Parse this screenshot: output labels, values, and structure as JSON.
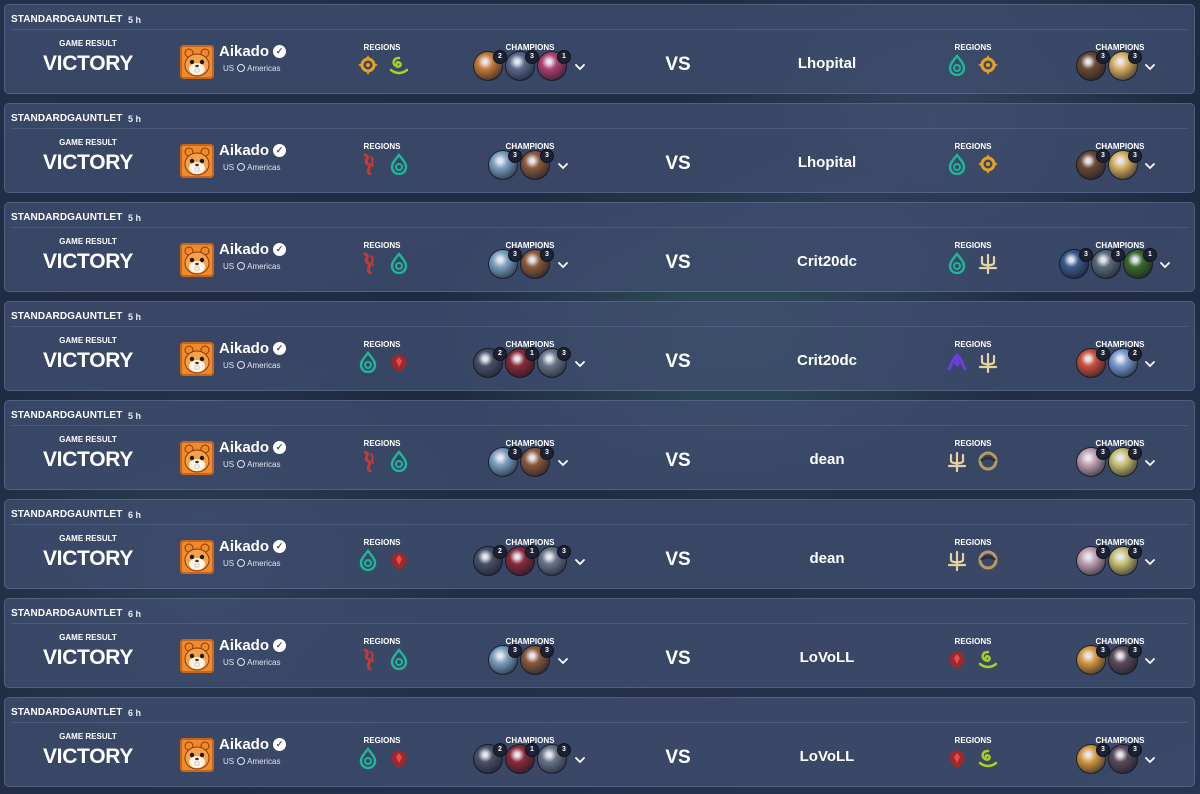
{
  "labels": {
    "game_result": "GAME RESULT",
    "regions": "REGIONS",
    "champions": "CHAMPIONS",
    "vs": "VS"
  },
  "player": {
    "name": "Aikado",
    "server": "US",
    "region": "Americas",
    "avatar_icon": "hamster-avatar-icon",
    "verified_icon": "verified-check-icon"
  },
  "colors": {
    "card_bg": "#404e70",
    "text": "#ffffff",
    "teal_region": "#1fb59a",
    "orange_region": "#e8a020",
    "green_region": "#a8d020",
    "red_region": "#c83a30",
    "noxus_region": "#a02828",
    "bilgewater_region": "#e6d2a0",
    "purple_region": "#6a3ee0",
    "shurima_region": "#b89a60"
  },
  "matches": [
    {
      "mode": "STANDARDGAUNTLET",
      "time": "5 h",
      "result": "VICTORY",
      "player_regions": [
        "targon-orange-icon",
        "bandle-green-icon"
      ],
      "player_champions": [
        {
          "count": "2",
          "color": "#c77a3a"
        },
        {
          "count": "3",
          "color": "#5a6a8a"
        },
        {
          "count": "1",
          "color": "#b04070"
        }
      ],
      "opponent": "Lhopital",
      "opponent_regions": [
        "shadow-isles-teal-icon",
        "targon-orange-icon"
      ],
      "opponent_champions": [
        {
          "count": "3",
          "color": "#6a4a32"
        },
        {
          "count": "3",
          "color": "#d8b060"
        }
      ]
    },
    {
      "mode": "STANDARDGAUNTLET",
      "time": "5 h",
      "result": "VICTORY",
      "player_regions": [
        "ionia-red-icon",
        "shadow-isles-teal-icon"
      ],
      "player_champions": [
        {
          "count": "3",
          "color": "#7aa0c0"
        },
        {
          "count": "3",
          "color": "#8a5a3a"
        }
      ],
      "opponent": "Lhopital",
      "opponent_regions": [
        "shadow-isles-teal-icon",
        "targon-orange-icon"
      ],
      "opponent_champions": [
        {
          "count": "3",
          "color": "#6a4a32"
        },
        {
          "count": "3",
          "color": "#d8b060"
        }
      ]
    },
    {
      "mode": "STANDARDGAUNTLET",
      "time": "5 h",
      "result": "VICTORY",
      "player_regions": [
        "ionia-red-icon",
        "shadow-isles-teal-icon"
      ],
      "player_champions": [
        {
          "count": "3",
          "color": "#7aa0c0"
        },
        {
          "count": "3",
          "color": "#8a5a3a"
        }
      ],
      "opponent": "Crit20dc",
      "opponent_regions": [
        "shadow-isles-teal-icon",
        "bilgewater-trident-icon"
      ],
      "opponent_champions": [
        {
          "count": "3",
          "color": "#3a5a8a"
        },
        {
          "count": "3",
          "color": "#5a6a7a"
        },
        {
          "count": "1",
          "color": "#3a6a2a"
        }
      ]
    },
    {
      "mode": "STANDARDGAUNTLET",
      "time": "5 h",
      "result": "VICTORY",
      "player_regions": [
        "shadow-isles-teal-icon",
        "noxus-red-icon"
      ],
      "player_champions": [
        {
          "count": "2",
          "color": "#4a5068"
        },
        {
          "count": "1",
          "color": "#8a2a3a"
        },
        {
          "count": "3",
          "color": "#6a7488"
        }
      ],
      "opponent": "Crit20dc",
      "opponent_regions": [
        "void-purple-icon",
        "bilgewater-trident-icon"
      ],
      "opponent_champions": [
        {
          "count": "3",
          "color": "#c8503a"
        },
        {
          "count": "2",
          "color": "#7a9ad0"
        }
      ]
    },
    {
      "mode": "STANDARDGAUNTLET",
      "time": "5 h",
      "result": "VICTORY",
      "player_regions": [
        "ionia-red-icon",
        "shadow-isles-teal-icon"
      ],
      "player_champions": [
        {
          "count": "3",
          "color": "#7aa0c0"
        },
        {
          "count": "3",
          "color": "#8a5a3a"
        }
      ],
      "opponent": "dean",
      "opponent_regions": [
        "bilgewater-trident-icon",
        "shurima-disc-icon"
      ],
      "opponent_champions": [
        {
          "count": "3",
          "color": "#c0a0b0"
        },
        {
          "count": "3",
          "color": "#c8c070"
        }
      ]
    },
    {
      "mode": "STANDARDGAUNTLET",
      "time": "6 h",
      "result": "VICTORY",
      "player_regions": [
        "shadow-isles-teal-icon",
        "noxus-red-icon"
      ],
      "player_champions": [
        {
          "count": "2",
          "color": "#4a5068"
        },
        {
          "count": "1",
          "color": "#8a2a3a"
        },
        {
          "count": "3",
          "color": "#6a7488"
        }
      ],
      "opponent": "dean",
      "opponent_regions": [
        "bilgewater-trident-icon",
        "shurima-disc-icon"
      ],
      "opponent_champions": [
        {
          "count": "3",
          "color": "#c0a0b0"
        },
        {
          "count": "3",
          "color": "#c8c070"
        }
      ]
    },
    {
      "mode": "STANDARDGAUNTLET",
      "time": "6 h",
      "result": "VICTORY",
      "player_regions": [
        "ionia-red-icon",
        "shadow-isles-teal-icon"
      ],
      "player_champions": [
        {
          "count": "3",
          "color": "#7aa0c0"
        },
        {
          "count": "3",
          "color": "#8a5a3a"
        }
      ],
      "opponent": "LoVoLL",
      "opponent_regions": [
        "noxus-red-icon",
        "bandle-green-icon"
      ],
      "opponent_champions": [
        {
          "count": "3",
          "color": "#d89a40"
        },
        {
          "count": "3",
          "color": "#5a4a5a"
        }
      ]
    },
    {
      "mode": "STANDARDGAUNTLET",
      "time": "6 h",
      "result": "VICTORY",
      "player_regions": [
        "shadow-isles-teal-icon",
        "noxus-red-icon"
      ],
      "player_champions": [
        {
          "count": "2",
          "color": "#4a5068"
        },
        {
          "count": "1",
          "color": "#8a2a3a"
        },
        {
          "count": "3",
          "color": "#6a7488"
        }
      ],
      "opponent": "LoVoLL",
      "opponent_regions": [
        "noxus-red-icon",
        "bandle-green-icon"
      ],
      "opponent_champions": [
        {
          "count": "3",
          "color": "#d89a40"
        },
        {
          "count": "3",
          "color": "#5a4a5a"
        }
      ]
    }
  ]
}
